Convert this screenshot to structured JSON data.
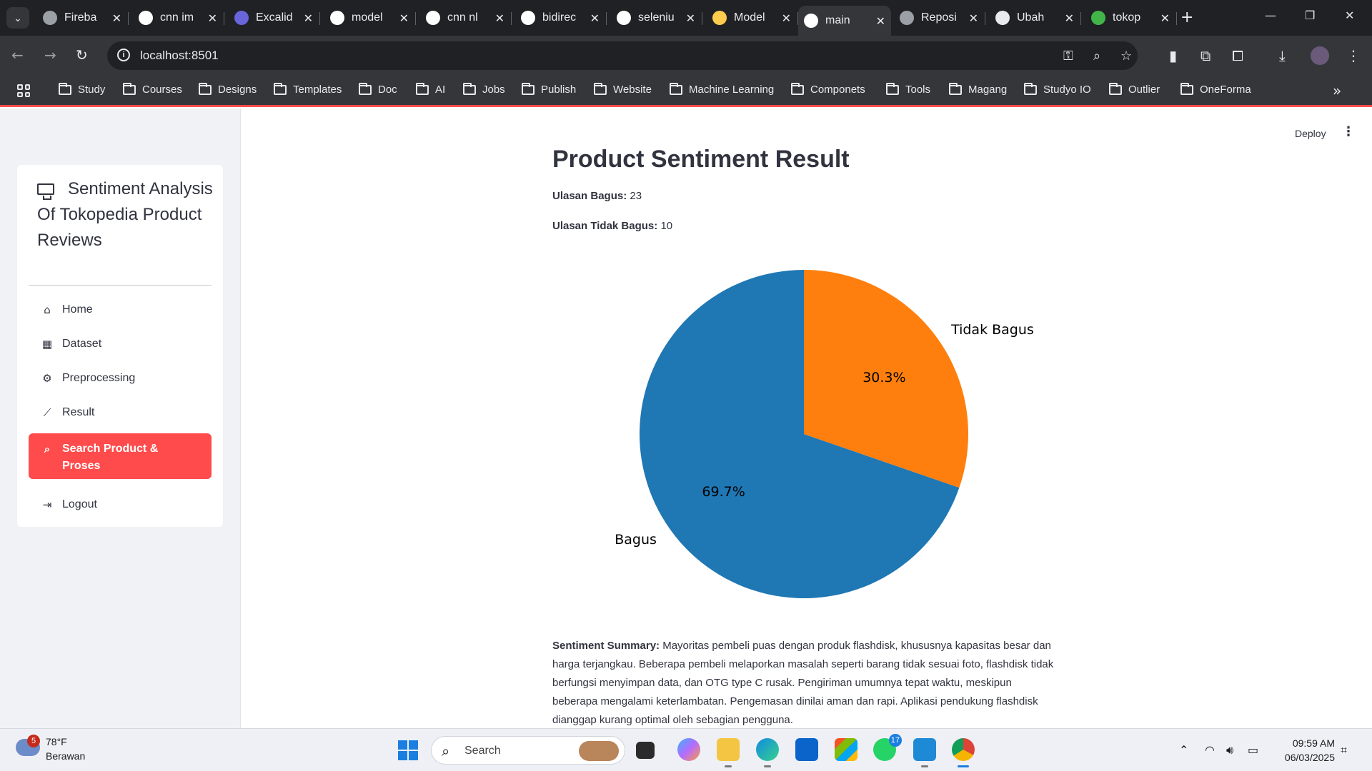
{
  "browser": {
    "tabs": [
      {
        "title": "Fireba",
        "favicon": "firebase-icon",
        "color": "#9aa0a6"
      },
      {
        "title": "cnn im",
        "favicon": "google-icon",
        "color": "#ffffff"
      },
      {
        "title": "Excalid",
        "favicon": "excalidraw-icon",
        "color": "#6965db"
      },
      {
        "title": "model",
        "favicon": "google-icon",
        "color": "#ffffff"
      },
      {
        "title": "cnn nl",
        "favicon": "google-icon",
        "color": "#ffffff"
      },
      {
        "title": "bidirec",
        "favicon": "google-icon",
        "color": "#ffffff"
      },
      {
        "title": "seleniu",
        "favicon": "google-icon",
        "color": "#ffffff"
      },
      {
        "title": "Model",
        "favicon": "huggingface-icon",
        "color": "#ffcc4d"
      },
      {
        "title": "main",
        "favicon": "streamlit-icon",
        "color": "#ffffff",
        "active": true
      },
      {
        "title": "Reposi",
        "favicon": "globe-icon",
        "color": "#9aa0a6"
      },
      {
        "title": "Ubah",
        "favicon": "chatgpt-icon",
        "color": "#e8eaed"
      },
      {
        "title": "tokop",
        "favicon": "tokopedia-icon",
        "color": "#42b549"
      }
    ],
    "url": "localhost:8501",
    "bookmarks": [
      "Study",
      "Courses",
      "Designs",
      "Templates",
      "Doc",
      "AI",
      "Jobs",
      "Publish",
      "Website",
      "Machine Learning",
      "Componets",
      "Tools",
      "Magang",
      "Studyo IO",
      "Outlier",
      "OneForma"
    ]
  },
  "sidebar": {
    "title": "Sentiment Analysis Of Tokopedia Product Reviews",
    "items": [
      {
        "label": "Home",
        "icon": "house-icon",
        "glyph": "⌂"
      },
      {
        "label": "Dataset",
        "icon": "table-icon",
        "glyph": "▦"
      },
      {
        "label": "Preprocessing",
        "icon": "gear-icon",
        "glyph": "⚙"
      },
      {
        "label": "Result",
        "icon": "line-chart-icon",
        "glyph": "⟋"
      },
      {
        "label": "Search Product & Proses",
        "icon": "search-icon",
        "glyph": "⌕",
        "active": true
      },
      {
        "label": "Logout",
        "icon": "logout-icon",
        "glyph": "⇥"
      }
    ],
    "active_color": "#ff4b4b"
  },
  "header": {
    "deploy_label": "Deploy",
    "menu_glyph": "⋮"
  },
  "main": {
    "title": "Product Sentiment Result",
    "good_label": "Ulasan Bagus:",
    "good_value": "23",
    "bad_label": "Ulasan Tidak Bagus:",
    "bad_value": "10",
    "summary_label": "Sentiment Summary:",
    "summary_text": "Mayoritas pembeli puas dengan produk flashdisk, khususnya kapasitas besar dan harga terjangkau. Beberapa pembeli melaporkan masalah seperti barang tidak sesuai foto, flashdisk tidak berfungsi menyimpan data, dan OTG type C rusak. Pengiriman umumnya tepat waktu, meskipun beberapa mengalami keterlambatan. Pengemasan dinilai aman dan rapi. Aplikasi pendukung flashdisk dianggap kurang optimal oleh sebagian pengguna."
  },
  "chart_data": {
    "type": "pie",
    "categories": [
      "Bagus",
      "Tidak Bagus"
    ],
    "values": [
      69.7,
      30.3
    ],
    "value_labels": [
      "69.7%",
      "30.3%"
    ],
    "colors": [
      "#1f77b4",
      "#ff7f0e"
    ],
    "title": "",
    "legend": false
  },
  "taskbar": {
    "weather_temp": "78°F",
    "weather_desc": "Berawan",
    "weather_badge": "5",
    "search_placeholder": "Search",
    "whatsapp_badge": "17",
    "time": "09:59 AM",
    "date": "06/03/2025"
  }
}
